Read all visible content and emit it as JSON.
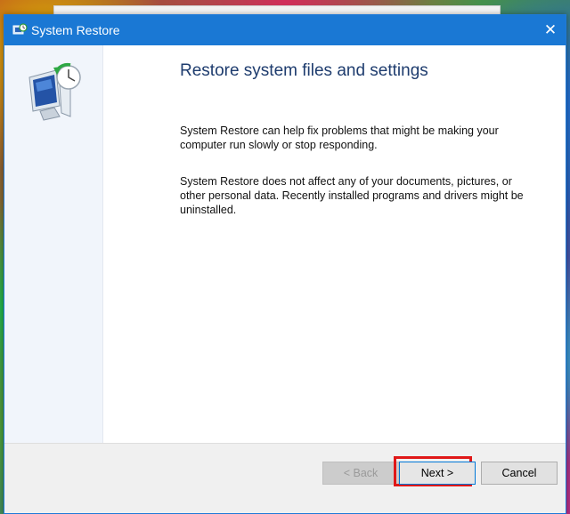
{
  "window": {
    "title": "System Restore",
    "close_glyph": "✕",
    "title_icon": "system-restore-icon"
  },
  "side_panel": {
    "icon": "restore-computer-icon"
  },
  "main": {
    "heading": "Restore system files and settings",
    "paragraph_1": "System Restore can help fix problems that might be making your computer run slowly or stop responding.",
    "paragraph_2": "System Restore does not affect any of your documents, pictures, or other personal data. Recently installed programs and drivers might be uninstalled."
  },
  "footer": {
    "back_label": "< Back",
    "next_label": "Next >",
    "cancel_label": "Cancel",
    "back_enabled": false,
    "highlight_color": "#e01818"
  },
  "colors": {
    "titlebar": "#1a78d4",
    "heading": "#1e3c6e",
    "side_panel": "#f1f5fb"
  }
}
